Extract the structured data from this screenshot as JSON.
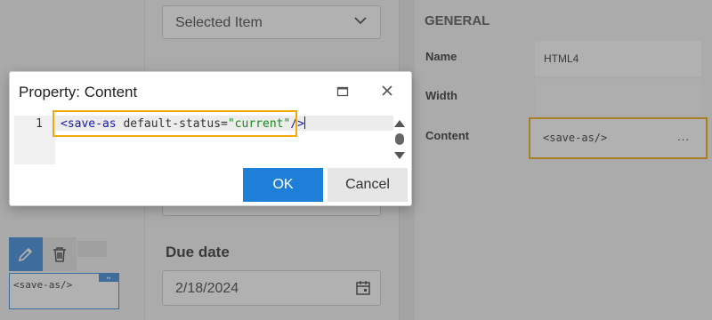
{
  "middle": {
    "select_value": "Selected Item",
    "due_label": "Due date",
    "due_value": "2/18/2024"
  },
  "properties": {
    "section_title": "GENERAL",
    "name_label": "Name",
    "name_value": "HTML4",
    "width_label": "Width",
    "width_value": "",
    "content_label": "Content",
    "content_value": "<save-as/>",
    "content_more": "..."
  },
  "canvas": {
    "chip_text": "<save-as/>",
    "chip_resize": "↔"
  },
  "dialog": {
    "title": "Property: Content",
    "line_number": "1",
    "code_tag_open": "<save-as",
    "code_attr": " default-status=",
    "code_value": "\"current\"",
    "code_tag_close": "/>",
    "ok_label": "OK",
    "cancel_label": "Cancel"
  },
  "colors": {
    "accent": "#1e7fd9",
    "highlight": "#f2a90d"
  }
}
